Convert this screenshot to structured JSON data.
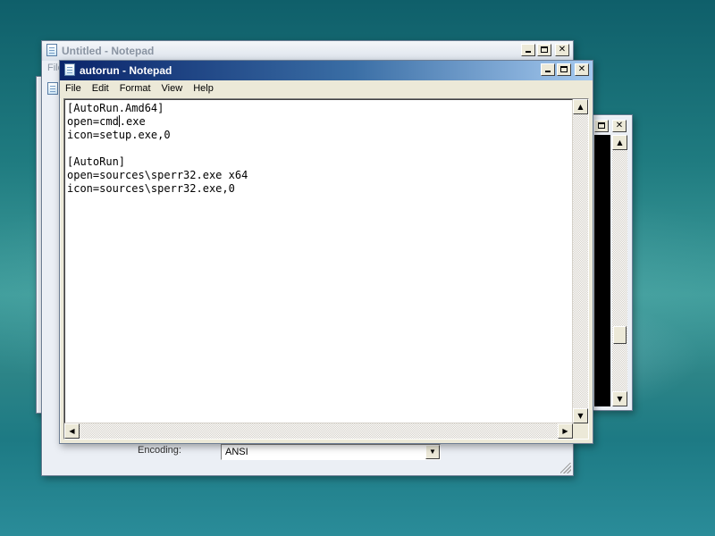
{
  "back_window": {
    "title": "Untitled - Notepad",
    "menu_fragment": "File",
    "encoding_label": "Encoding:",
    "encoding_value": "ANSI"
  },
  "front_window": {
    "title": "autorun - Notepad",
    "menu": [
      "File",
      "Edit",
      "Format",
      "View",
      "Help"
    ],
    "lines": [
      "[AutoRun.Amd64]",
      "open=cmd.exe",
      "icon=setup.exe,0",
      "",
      "[AutoRun]",
      "open=sources\\sperr32.exe x64",
      "icon=sources\\sperr32.exe,0"
    ],
    "caret_after": "open=cmd",
    "caret_before": ".exe"
  },
  "controls": {
    "close_glyph": "✕"
  },
  "icons": [
    "notepad-icon",
    "minimize-icon",
    "maximize-icon",
    "close-icon",
    "scroll-up-icon",
    "scroll-down-icon",
    "scroll-left-icon",
    "scroll-right-icon",
    "dropdown-arrow-icon"
  ],
  "colors": {
    "active_title_start": "#0a246a",
    "active_title_end": "#a6caf0",
    "console_background": "#000000"
  }
}
